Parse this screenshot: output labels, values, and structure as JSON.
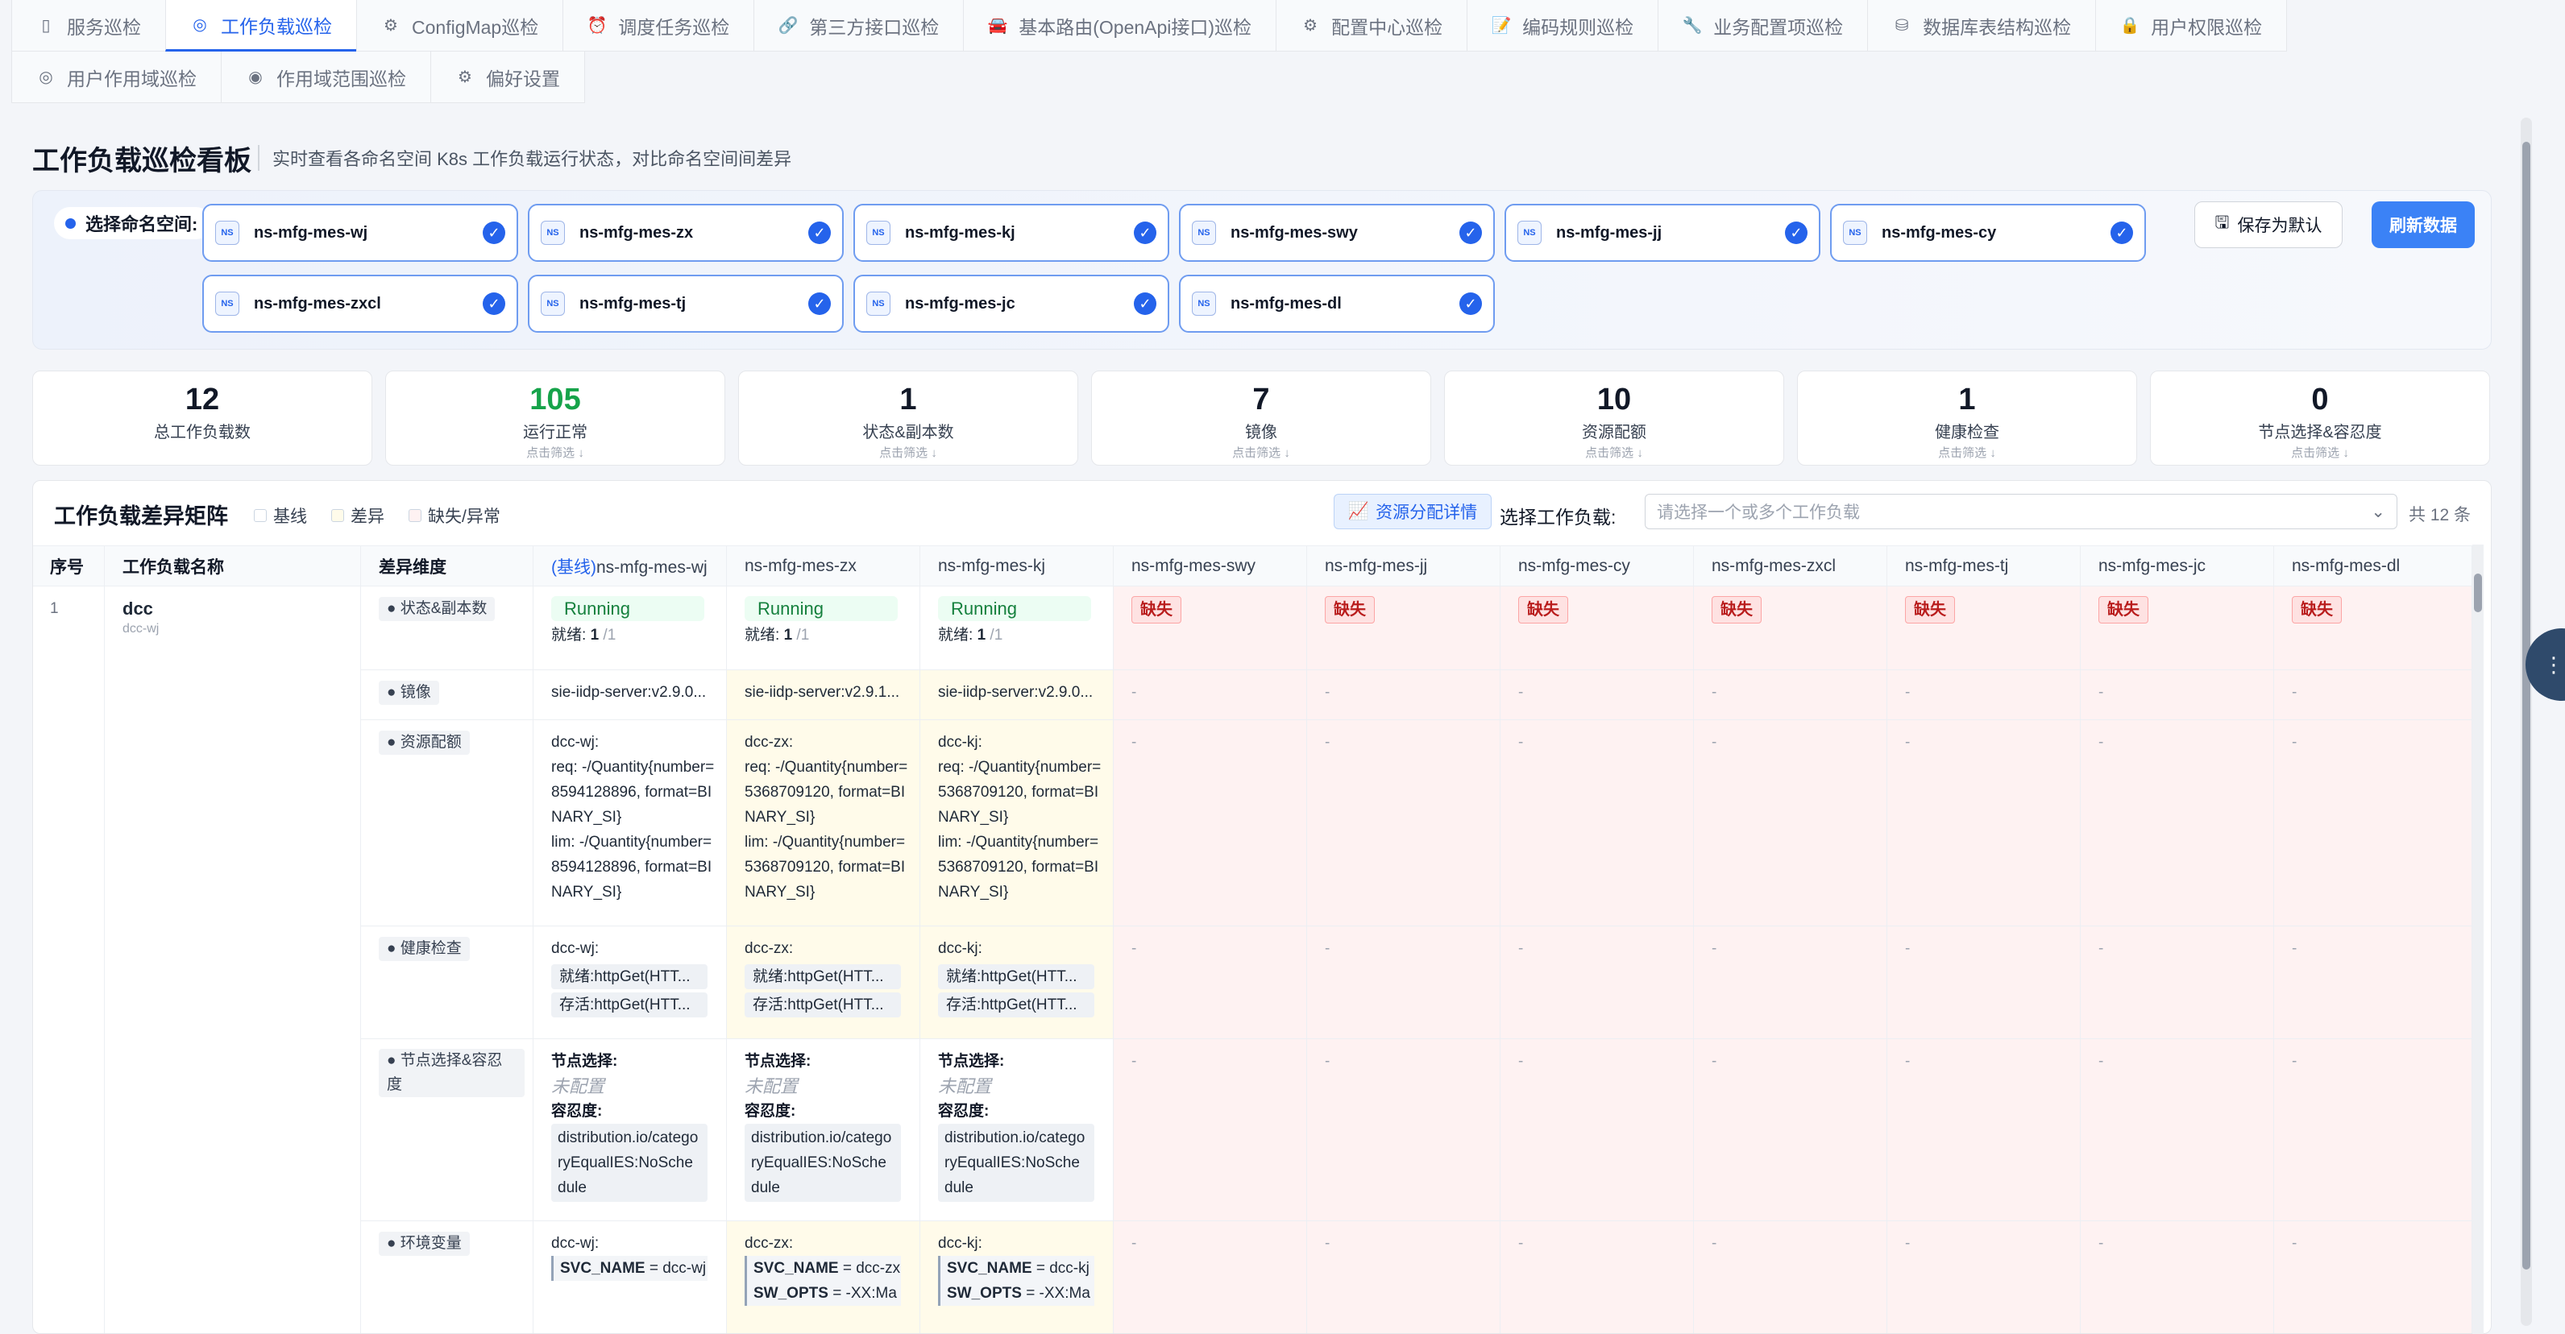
{
  "tabs": [
    {
      "label": "服务巡检",
      "icon": "server-icon",
      "glyph": "▯"
    },
    {
      "label": "工作负载巡检",
      "icon": "target-icon",
      "glyph": "◎",
      "active": true
    },
    {
      "label": "ConfigMap巡检",
      "icon": "gear-icon",
      "glyph": "⚙"
    },
    {
      "label": "调度任务巡检",
      "icon": "alarm-clock-icon",
      "glyph": "⏰"
    },
    {
      "label": "第三方接口巡检",
      "icon": "link-icon",
      "glyph": "🔗"
    },
    {
      "label": "基本路由(OpenApi接口)巡检",
      "icon": "car-icon",
      "glyph": "🚘"
    },
    {
      "label": "配置中心巡检",
      "icon": "gear-icon",
      "glyph": "⚙"
    },
    {
      "label": "编码规则巡检",
      "icon": "memo-icon",
      "glyph": "📝"
    },
    {
      "label": "业务配置项巡检",
      "icon": "wrench-icon",
      "glyph": "🔧"
    },
    {
      "label": "数据库表结构巡检",
      "icon": "database-icon",
      "glyph": "⛁"
    },
    {
      "label": "用户权限巡检",
      "icon": "lock-icon",
      "glyph": "🔒"
    },
    {
      "label": "用户作用域巡检",
      "icon": "target-icon",
      "glyph": "◎"
    },
    {
      "label": "作用域范围巡检",
      "icon": "compass-icon",
      "glyph": "◉"
    },
    {
      "label": "偏好设置",
      "icon": "gear-icon",
      "glyph": "⚙"
    }
  ],
  "page": {
    "title": "工作负载巡检看板",
    "subtitle": "实时查看各命名空间 K8s 工作负载运行状态，对比命名空间间差异"
  },
  "namespace_selector": {
    "label": "选择命名空间:",
    "badge": "NS",
    "namespaces": [
      "ns-mfg-mes-wj",
      "ns-mfg-mes-zx",
      "ns-mfg-mes-kj",
      "ns-mfg-mes-swy",
      "ns-mfg-mes-jj",
      "ns-mfg-mes-cy",
      "ns-mfg-mes-zxcl",
      "ns-mfg-mes-tj",
      "ns-mfg-mes-jc",
      "ns-mfg-mes-dl"
    ],
    "save_label": "保存为默认",
    "refresh_label": "刷新数据"
  },
  "stats": [
    {
      "value": "12",
      "label": "总工作负载数",
      "hint": ""
    },
    {
      "value": "105",
      "label": "运行正常",
      "hint": "点击筛选 ↓",
      "color": "#16a34a"
    },
    {
      "value": "1",
      "label": "状态&副本数",
      "hint": "点击筛选 ↓"
    },
    {
      "value": "7",
      "label": "镜像",
      "hint": "点击筛选 ↓"
    },
    {
      "value": "10",
      "label": "资源配额",
      "hint": "点击筛选 ↓"
    },
    {
      "value": "1",
      "label": "健康检查",
      "hint": "点击筛选 ↓"
    },
    {
      "value": "0",
      "label": "节点选择&容忍度",
      "hint": "点击筛选 ↓"
    }
  ],
  "matrix": {
    "title": "工作负载差异矩阵",
    "legend": [
      "基线",
      "差异",
      "缺失/异常"
    ],
    "legend_colors": [
      "#ffffff",
      "#fffbea",
      "#fef2f2"
    ],
    "resource_button": "资源分配详情",
    "select_label": "选择工作负载:",
    "select_placeholder": "请选择一个或多个工作负载",
    "count": "共 12 条",
    "headers": {
      "index": "序号",
      "name": "工作负载名称",
      "dimension": "差异维度",
      "baseline_tag": "(基线)"
    },
    "missing_label": "缺失",
    "dash": "-",
    "row": {
      "index": "1",
      "name": "dcc",
      "sub": "dcc-wj",
      "dimensions": {
        "status": "● 状态&副本数",
        "image": "● 镜像",
        "resource": "● 资源配额",
        "health": "● 健康检查",
        "node": "● 节点选择&容忍度",
        "env": "● 环境变量"
      },
      "cells": [
        {
          "status": "Running",
          "ready_label": "就绪:",
          "ready": "1",
          "total": "/1",
          "image": "sie-iidp-server:v2.9.0...",
          "res_head": "dcc-wj:",
          "req": "req: -/Quantity{number=8594128896, format=BINARY_SI}",
          "lim": "lim: -/Quantity{number=8594128896, format=BINARY_SI}",
          "hc_head": "dcc-wj:",
          "ready_probe": "就绪:httpGet(HTT...",
          "live_probe": "存活:httpGet(HTT...",
          "node_label": "节点选择:",
          "node_value": "未配置",
          "tol_label": "容忍度:",
          "tol_value": "distribution.io/categoryEqualIES:NoSchedule",
          "env_head": "dcc-wj:",
          "env1_k": "SVC_NAME",
          "env1_v": "= dcc-wj",
          "env2_k": "",
          "env2_v": ""
        },
        {
          "status": "Running",
          "ready_label": "就绪:",
          "ready": "1",
          "total": "/1",
          "image": "sie-iidp-server:v2.9.1...",
          "res_head": "dcc-zx:",
          "req": "req: -/Quantity{number=5368709120, format=BINARY_SI}",
          "lim": "lim: -/Quantity{number=5368709120, format=BINARY_SI}",
          "hc_head": "dcc-zx:",
          "ready_probe": "就绪:httpGet(HTT...",
          "live_probe": "存活:httpGet(HTT...",
          "node_label": "节点选择:",
          "node_value": "未配置",
          "tol_label": "容忍度:",
          "tol_value": "distribution.io/categoryEqualIES:NoSchedule",
          "env_head": "dcc-zx:",
          "env1_k": "SVC_NAME",
          "env1_v": "= dcc-zx",
          "env2_k": "SW_OPTS",
          "env2_v": "= -XX:Ma"
        },
        {
          "status": "Running",
          "ready_label": "就绪:",
          "ready": "1",
          "total": "/1",
          "image": "sie-iidp-server:v2.9.0...",
          "res_head": "dcc-kj:",
          "req": "req: -/Quantity{number=5368709120, format=BINARY_SI}",
          "lim": "lim: -/Quantity{number=5368709120, format=BINARY_SI}",
          "hc_head": "dcc-kj:",
          "ready_probe": "就绪:httpGet(HTT...",
          "live_probe": "存活:httpGet(HTT...",
          "node_label": "节点选择:",
          "node_value": "未配置",
          "tol_label": "容忍度:",
          "tol_value": "distribution.io/categoryEqualIES:NoSchedule",
          "env_head": "dcc-kj:",
          "env1_k": "SVC_NAME",
          "env1_v": "= dcc-kj",
          "env2_k": "SW_OPTS",
          "env2_v": "= -XX:Ma"
        }
      ]
    }
  }
}
